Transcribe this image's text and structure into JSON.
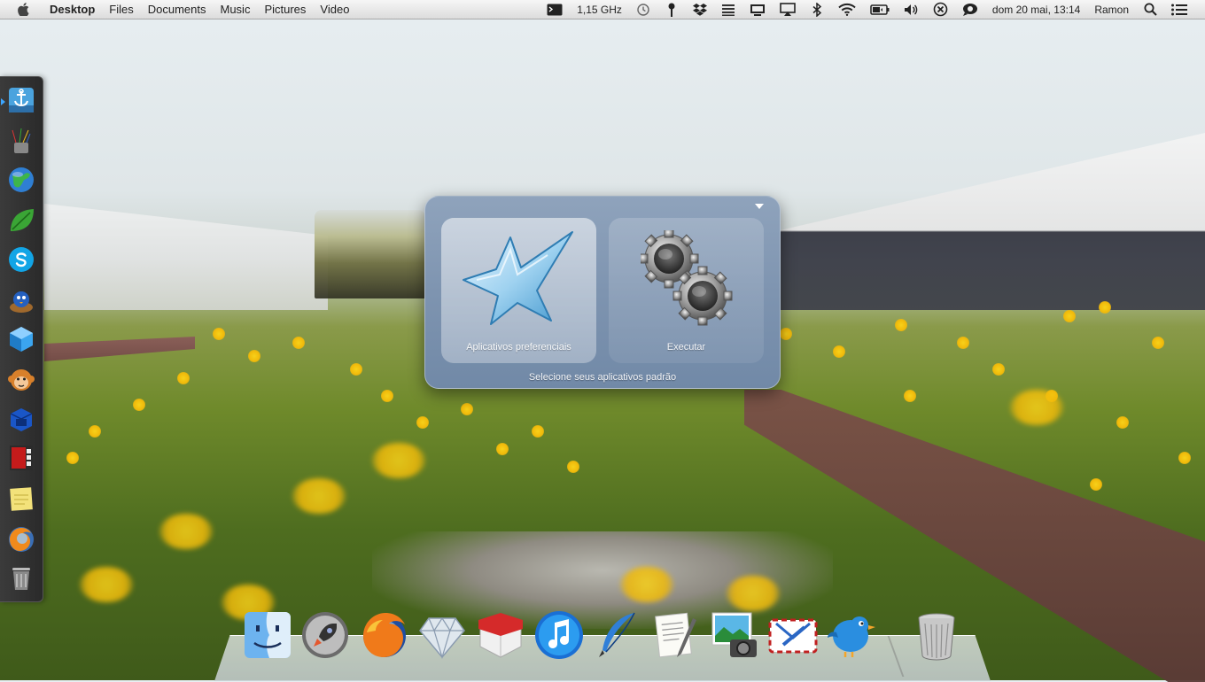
{
  "menubar": {
    "app_name": "Desktop",
    "menus": [
      "Files",
      "Documents",
      "Music",
      "Pictures",
      "Video"
    ],
    "cpu_freq": "1,15 GHz",
    "clock": "dom 20 mai, 13:14",
    "user": "Ramon",
    "icons": [
      "apple-icon",
      "terminal-icon",
      "time-machine-icon",
      "pin-icon",
      "dropbox-icon",
      "list-icon",
      "display-icon",
      "airplay-icon",
      "bluetooth-icon",
      "wifi-icon",
      "battery-icon",
      "volume-icon",
      "close-circle-icon",
      "chat-icon",
      "search-icon",
      "list-menu-icon"
    ]
  },
  "left_dock": {
    "items": [
      "anchor-app",
      "pencils-app",
      "globe-app",
      "leaf-app",
      "skype-app",
      "bird-nest-app",
      "cube-app",
      "monkey-app",
      "blue-box-app",
      "photo-booth-app",
      "sticky-notes-app",
      "firefox-orb-app",
      "trash-app"
    ]
  },
  "dialog": {
    "tiles": [
      {
        "label": "Aplicativos preferenciais",
        "selected": true
      },
      {
        "label": "Executar",
        "selected": false
      }
    ],
    "caption": "Selecione seus aplicativos padrão"
  },
  "dock": {
    "items": [
      "finder",
      "launchpad",
      "firefox",
      "sketch",
      "inbox-box",
      "itunes",
      "quill",
      "textedit",
      "image-capture",
      "mail-airmail",
      "twitter-bird",
      "trash"
    ]
  },
  "colors": {
    "dialog_bg": "#7e94b0",
    "menubar_bg": "#e8e8e8",
    "leftdock_bg": "#333333"
  }
}
